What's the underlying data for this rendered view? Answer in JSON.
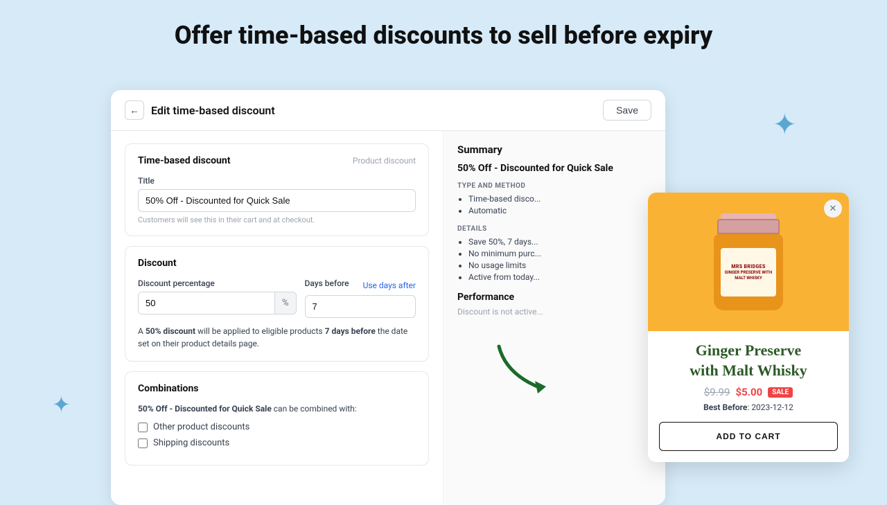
{
  "page": {
    "title": "Offer time-based discounts to sell before expiry"
  },
  "header": {
    "back_icon": "←",
    "title": "Edit time-based discount",
    "save_label": "Save"
  },
  "left": {
    "section1": {
      "title": "Time-based discount",
      "subtitle": "Product discount",
      "title_field_label": "Title",
      "title_value": "50% Off - Discounted for Quick Sale",
      "title_hint": "Customers will see this in their cart and at checkout."
    },
    "section2": {
      "title": "Discount",
      "discount_pct_label": "Discount percentage",
      "discount_pct_value": "50",
      "discount_pct_suffix": "%",
      "days_label": "Days before",
      "days_value": "7",
      "use_days_after_link": "Use days after",
      "description_line1": "A ",
      "description_bold1": "50% discount",
      "description_line2": " will be applied to eligible products ",
      "description_bold2": "7 days before",
      "description_line3": " the date set on their product details page."
    },
    "section3": {
      "title": "Combinations",
      "combo_text_prefix": "",
      "combo_bold": "50% Off - Discounted for Quick Sale",
      "combo_text_suffix": " can be combined with:",
      "checkbox1_label": "Other product discounts",
      "checkbox2_label": "Shipping discounts"
    }
  },
  "right": {
    "summary_title": "Summary",
    "discount_name": "50% Off - Discounted for Quick Sale",
    "type_method_label": "TYPE AND METHOD",
    "type_items": [
      "Time-based disco...",
      "Automatic"
    ],
    "details_label": "DETAILS",
    "detail_items": [
      "Save 50%, 7 days...",
      "No minimum purc...",
      "No usage limits",
      "Active from today..."
    ],
    "performance_title": "Performance",
    "performance_text": "Discount is not active..."
  },
  "popup": {
    "close_icon": "✕",
    "product_name": "Ginger Preserve\nwith Malt Whisky",
    "original_price": "$9.99",
    "sale_price": "$5.00",
    "sale_badge": "SALE",
    "best_before_label": "Best Before",
    "best_before_date": "2023-12-12",
    "add_to_cart_label": "ADD TO CART"
  },
  "stars": {
    "top_right": "✦",
    "bottom_left": "✦"
  }
}
